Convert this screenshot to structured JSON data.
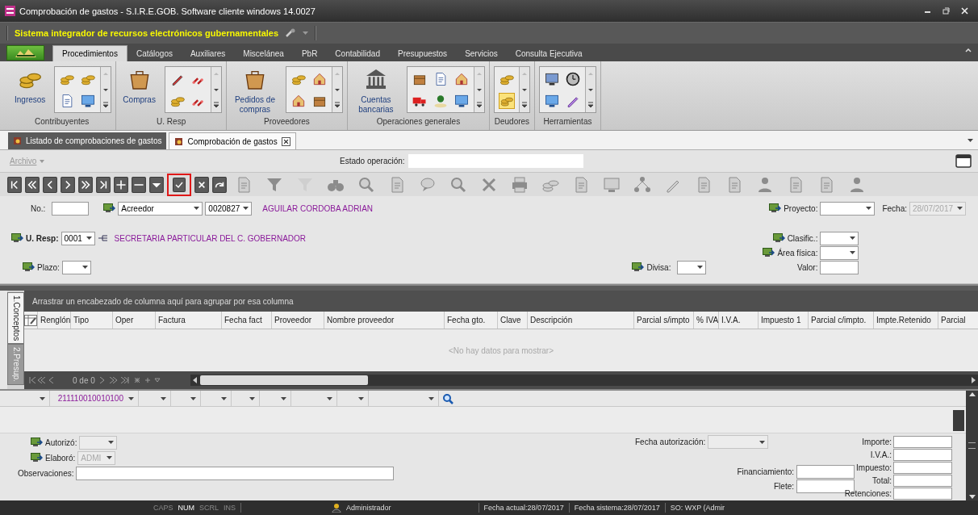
{
  "window": {
    "title": "Comprobación de gastos - S.I.R.E.GOB. Software cliente windows 14.0027"
  },
  "app_bar": {
    "title": "Sistema integrador de recursos electrónicos gubernamentales"
  },
  "ribbon": {
    "tabs": [
      {
        "label": "Procedimientos",
        "selected": true
      },
      {
        "label": "Catálogos",
        "selected": false
      },
      {
        "label": "Auxiliares",
        "selected": false
      },
      {
        "label": "Miscelánea",
        "selected": false
      },
      {
        "label": "PbR",
        "selected": false
      },
      {
        "label": "Contabilidad",
        "selected": false
      },
      {
        "label": "Presupuestos",
        "selected": false
      },
      {
        "label": "Servicios",
        "selected": false
      },
      {
        "label": "Consulta Ejecutiva",
        "selected": false
      }
    ],
    "groups": [
      {
        "label": "Contribuyentes",
        "button": {
          "label": "Ingresos",
          "kind": "money"
        },
        "icons": [
          {
            "kind": "money",
            "selected": false
          },
          {
            "kind": "document",
            "selected": false
          },
          {
            "kind": "money",
            "selected": false
          },
          {
            "kind": "screen",
            "selected": false
          }
        ]
      },
      {
        "label": "U. Resp",
        "button": {
          "label": "Compras",
          "kind": "bag"
        },
        "icons": [
          {
            "kind": "tools",
            "selected": false
          },
          {
            "kind": "money",
            "selected": false
          },
          {
            "kind": "link",
            "selected": false
          },
          {
            "kind": "link",
            "selected": false
          }
        ]
      },
      {
        "label": "Proveedores",
        "button": {
          "label": "Pedidos de compras",
          "kind": "bag"
        },
        "icons": [
          {
            "kind": "money",
            "selected": false
          },
          {
            "kind": "house",
            "selected": false
          },
          {
            "kind": "house",
            "selected": false
          },
          {
            "kind": "box",
            "selected": false
          }
        ]
      },
      {
        "label": "Operaciones generales",
        "button": {
          "label": "Cuentas bancarias",
          "kind": "bank"
        },
        "icons": [
          {
            "kind": "box",
            "selected": false
          },
          {
            "kind": "truck",
            "selected": false
          },
          {
            "kind": "document",
            "selected": false
          },
          {
            "kind": "map",
            "selected": false
          },
          {
            "kind": "house",
            "selected": false
          },
          {
            "kind": "screen",
            "selected": false
          }
        ]
      },
      {
        "label": "Deudores",
        "icons": [
          {
            "kind": "money",
            "selected": false
          },
          {
            "kind": "money",
            "selected": true
          }
        ]
      },
      {
        "label": "Herramientas",
        "icons": [
          {
            "kind": "calc",
            "selected": false
          },
          {
            "kind": "screen",
            "selected": false
          },
          {
            "kind": "clock",
            "selected": false
          },
          {
            "kind": "pen",
            "selected": false
          }
        ]
      }
    ]
  },
  "document_tabs": [
    {
      "label": "Listado de comprobaciones de gastos",
      "selected": false,
      "closable": false
    },
    {
      "label": "Comprobación de gastos",
      "selected": true,
      "closable": true
    }
  ],
  "menu": {
    "items": [
      {
        "label": "Archivo",
        "disabled": true
      }
    ],
    "status_label": "Estado operación:"
  },
  "toolbar": {
    "buttons": [
      {
        "kind": "first",
        "disabled": false,
        "highlighted": false
      },
      {
        "kind": "prev-page",
        "disabled": false,
        "highlighted": false
      },
      {
        "kind": "prev",
        "disabled": false,
        "highlighted": false
      },
      {
        "kind": "next",
        "disabled": false,
        "highlighted": false
      },
      {
        "kind": "next-page",
        "disabled": false,
        "highlighted": false
      },
      {
        "kind": "last",
        "disabled": false,
        "highlighted": false
      },
      {
        "kind": "add",
        "disabled": false,
        "highlighted": false
      },
      {
        "kind": "remove",
        "disabled": false,
        "highlighted": false
      },
      {
        "kind": "down",
        "disabled": false,
        "highlighted": false
      },
      {
        "kind": "confirm",
        "disabled": false,
        "highlighted": true
      },
      {
        "kind": "cancel",
        "disabled": false,
        "highlighted": false
      },
      {
        "kind": "redo",
        "disabled": false,
        "highlighted": false
      },
      {
        "kind": "copy",
        "disabled": true,
        "highlighted": false
      },
      {
        "kind": "filter",
        "disabled": true,
        "highlighted": false
      },
      {
        "kind": "filter-clear",
        "disabled": true,
        "highlighted": false
      },
      {
        "kind": "binoculars",
        "disabled": true,
        "highlighted": false
      },
      {
        "kind": "search",
        "disabled": true,
        "highlighted": false
      },
      {
        "kind": "edit",
        "disabled": true,
        "highlighted": false
      },
      {
        "kind": "chat",
        "disabled": true,
        "highlighted": false
      },
      {
        "kind": "find",
        "disabled": true,
        "highlighted": false
      },
      {
        "kind": "delete",
        "disabled": true,
        "highlighted": false
      },
      {
        "kind": "print",
        "disabled": true,
        "highlighted": false
      },
      {
        "kind": "money",
        "disabled": true,
        "highlighted": false
      },
      {
        "kind": "compare",
        "disabled": true,
        "highlighted": false
      },
      {
        "kind": "grid",
        "disabled": true,
        "highlighted": false
      },
      {
        "kind": "tree",
        "disabled": true,
        "highlighted": false
      },
      {
        "kind": "pen",
        "disabled": true,
        "highlighted": false
      },
      {
        "kind": "page",
        "disabled": true,
        "highlighted": false
      },
      {
        "kind": "calc",
        "disabled": true,
        "highlighted": false
      },
      {
        "kind": "user",
        "disabled": true,
        "highlighted": false
      },
      {
        "kind": "report",
        "disabled": true,
        "highlighted": false
      },
      {
        "kind": "document",
        "disabled": true,
        "highlighted": false
      },
      {
        "kind": "users",
        "disabled": true,
        "highlighted": false
      }
    ]
  },
  "header_form": {
    "number": {
      "label": "No.:"
    },
    "party_type": {
      "value": "Acreedor"
    },
    "party_code": {
      "value": "0020827"
    },
    "party_name": "AGUILAR CORDOBA ADRIAN",
    "project": {
      "label": "Proyecto:"
    },
    "date": {
      "label": "Fecha:",
      "value": "28/07/2017",
      "disabled": true
    },
    "unit": {
      "label": "U. Resp:",
      "value": "0001"
    },
    "unit_name": "SECRETARIA PARTICULAR DEL C. GOBERNADOR",
    "classification": {
      "label": "Clasific.:"
    },
    "physical_area": {
      "label": "Área física:"
    },
    "amount": {
      "label": "Valor:"
    },
    "term": {
      "label": "Plazo:"
    },
    "currency": {
      "label": "Divisa:"
    }
  },
  "grid": {
    "tabs": [
      {
        "label": "1.Conceptos",
        "selected": true
      },
      {
        "label": "2.Presup.",
        "selected": false
      }
    ],
    "group_hint": "Arrastrar un encabezado de columna aquí para agrupar por esa columna",
    "columns": [
      "Renglón",
      "Tipo",
      "Oper",
      "Factura",
      "Fecha fact",
      "Proveedor",
      "Nombre proveedor",
      "Fecha gto.",
      "Clave",
      "Descripción",
      "Parcial s/impto",
      "% IVA",
      "I.V.A.",
      "Impuesto 1",
      "Parcial c/impto.",
      "Impte.Retenido",
      "Parcial"
    ],
    "empty_text": "<No hay datos para mostrar>",
    "counter": "0 de 0"
  },
  "footer_form": {
    "account": "211110010010100",
    "authorized": {
      "label": "Autorizó:",
      "disabled": true
    },
    "prepared": {
      "label": "Elaboró:",
      "value": "ADMI",
      "disabled": true
    },
    "notes": {
      "label": "Observaciones:"
    },
    "authorization_date": {
      "label": "Fecha autorización:",
      "disabled": true
    },
    "financing": {
      "label": "Financiamiento:"
    },
    "freight": {
      "label": "Flete:"
    },
    "totals": [
      {
        "label": "Importe:"
      },
      {
        "label": "I.V.A.:"
      },
      {
        "label": "Impuesto:"
      },
      {
        "label": "Total:"
      },
      {
        "label": "Retenciones:"
      }
    ]
  },
  "status_bar": {
    "keys": [
      {
        "label": "CAPS",
        "on": false
      },
      {
        "label": "NUM",
        "on": true
      },
      {
        "label": "SCRL",
        "on": false
      },
      {
        "label": "INS",
        "on": false
      }
    ],
    "user": "Administrador",
    "items": [
      "Fecha actual:28/07/2017",
      "Fecha sistema:28/07/2017",
      "SO: WXP (Admir"
    ]
  }
}
